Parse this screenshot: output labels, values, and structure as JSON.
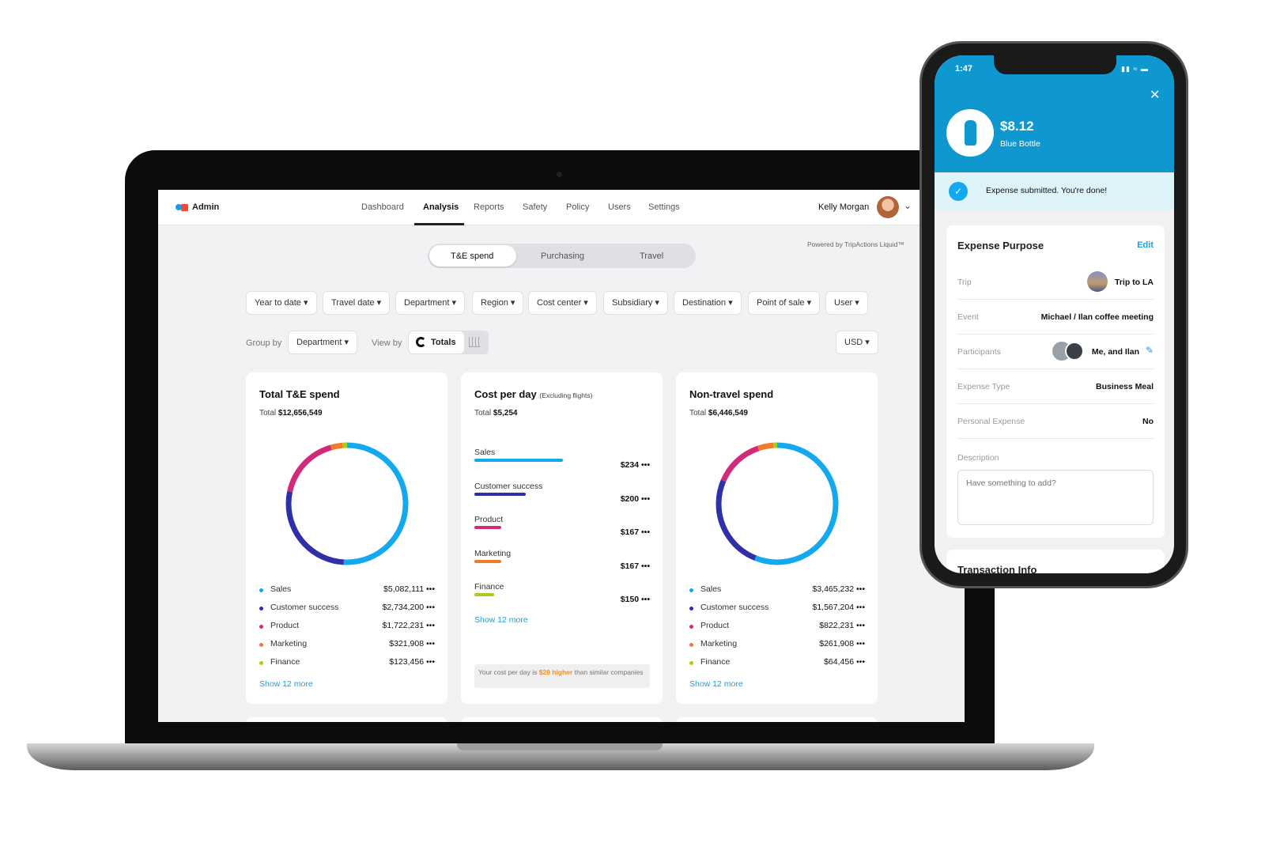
{
  "app": {
    "logo_label": "Admin",
    "nav": [
      "Dashboard",
      "Analysis",
      "Reports",
      "Safety",
      "Policy",
      "Users",
      "Settings"
    ],
    "active_nav": "Analysis",
    "user_name": "Kelly Morgan",
    "powered_by": "Powered by TripActions Liquid™"
  },
  "tabs": {
    "items": [
      "T&E spend",
      "Purchasing",
      "Travel"
    ],
    "active": "T&E spend"
  },
  "filters": [
    "Year to date ▾",
    "Travel date ▾",
    "Department ▾",
    "Region ▾",
    "Cost center ▾",
    "Subsidiary ▾",
    "Destination ▾",
    "Point of sale ▾",
    "User ▾"
  ],
  "controls": {
    "group_by_label": "Group by",
    "group_by_value": "Department ▾",
    "view_by_label": "View by",
    "view_by_value": "Totals",
    "currency": "USD ▾"
  },
  "colors": {
    "Sales": "#13a9f0",
    "Customer success": "#2f2fa8",
    "Product": "#d12a78",
    "Marketing": "#f47a2b",
    "Finance": "#a9cc1a"
  },
  "cards": [
    {
      "title": "Total T&E spend",
      "total_label": "Total",
      "total": "$12,656,549",
      "more": "Show 12 more",
      "chart_data": {
        "type": "pie",
        "categories": [
          "Sales",
          "Customer success",
          "Product",
          "Marketing",
          "Finance"
        ],
        "values": [
          5082111,
          2734200,
          1722231,
          321908,
          123456
        ],
        "labels": [
          "$5,082,111",
          "$2,734,200",
          "$1,722,231",
          "$321,908",
          "$123,456"
        ]
      }
    },
    {
      "title": "Cost per day",
      "subtitle": "(Excluding flights)",
      "total_label": "Total",
      "total": "$5,254",
      "more": "Show 12 more",
      "note_pre": "Your cost per day is ",
      "note_hl": "$20 higher",
      "note_post": " than similar companies",
      "chart_data": {
        "type": "bar",
        "categories": [
          "Sales",
          "Customer success",
          "Product",
          "Marketing",
          "Finance"
        ],
        "values": [
          234,
          200,
          167,
          167,
          150
        ],
        "labels": [
          "$234",
          "$200",
          "$167",
          "$167",
          "$150"
        ]
      }
    },
    {
      "title": "Non-travel spend",
      "total_label": "Total",
      "total": "$6,446,549",
      "more": "Show 12 more",
      "chart_data": {
        "type": "pie",
        "categories": [
          "Sales",
          "Customer success",
          "Product",
          "Marketing",
          "Finance"
        ],
        "values": [
          3465232,
          1567204,
          822231,
          261908,
          64456
        ],
        "labels": [
          "$3,465,232",
          "$1,567,204",
          "$822,231",
          "$261,908",
          "$64,456"
        ]
      }
    }
  ],
  "phone": {
    "time": "1:47",
    "amount": "$8.12",
    "merchant": "Blue Bottle",
    "banner": "Expense submitted. You're done!",
    "section_title": "Expense Purpose",
    "edit": "Edit",
    "rows": [
      {
        "k": "Trip",
        "v": "Trip to LA"
      },
      {
        "k": "Event",
        "v": "Michael / Ilan coffee meeting"
      },
      {
        "k": "Participants",
        "v": "Me, and Ilan"
      },
      {
        "k": "Expense Type",
        "v": "Business Meal"
      },
      {
        "k": "Personal Expense",
        "v": "No"
      }
    ],
    "description_label": "Description",
    "description_placeholder": "Have something to add?",
    "next_section": "Transaction Info"
  }
}
